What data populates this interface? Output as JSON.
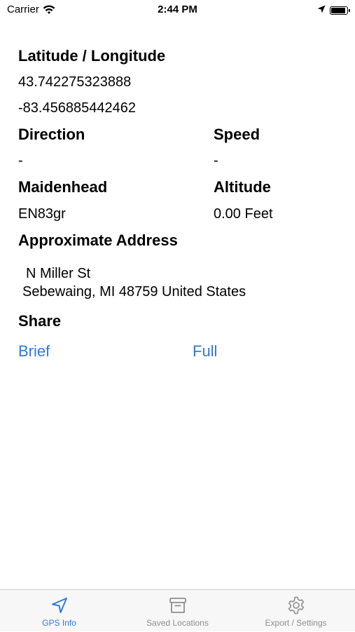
{
  "status_bar": {
    "carrier": "Carrier",
    "time": "2:44 PM",
    "wifi_icon": "wifi-icon",
    "location_icon": "location-arrow-icon",
    "battery_icon": "battery-icon",
    "battery_level": 0.95
  },
  "gps": {
    "lat_lon_heading": "Latitude / Longitude",
    "latitude": "43.742275323888",
    "longitude": "-83.456885442462",
    "direction_heading": "Direction",
    "direction_value": "-",
    "speed_heading": "Speed",
    "speed_value": "-",
    "maidenhead_heading": "Maidenhead",
    "maidenhead_value": "EN83gr",
    "altitude_heading": "Altitude",
    "altitude_value": "0.00 Feet",
    "address_heading": "Approximate Address",
    "address_line1": "N Miller St",
    "address_line2": "Sebewaing, MI 48759 United States",
    "share_heading": "Share",
    "share_brief": "Brief",
    "share_full": "Full"
  },
  "tab_bar": {
    "tabs": [
      {
        "label": "GPS Info",
        "icon": "location-arrow-icon",
        "active": true
      },
      {
        "label": "Saved Locations",
        "icon": "archive-box-icon",
        "active": false
      },
      {
        "label": "Export / Settings",
        "icon": "gear-icon",
        "active": false
      }
    ]
  },
  "colors": {
    "accent": "#2f7ad6",
    "inactive": "#8e8e93",
    "tab_bar_bg": "#f7f7f7"
  }
}
